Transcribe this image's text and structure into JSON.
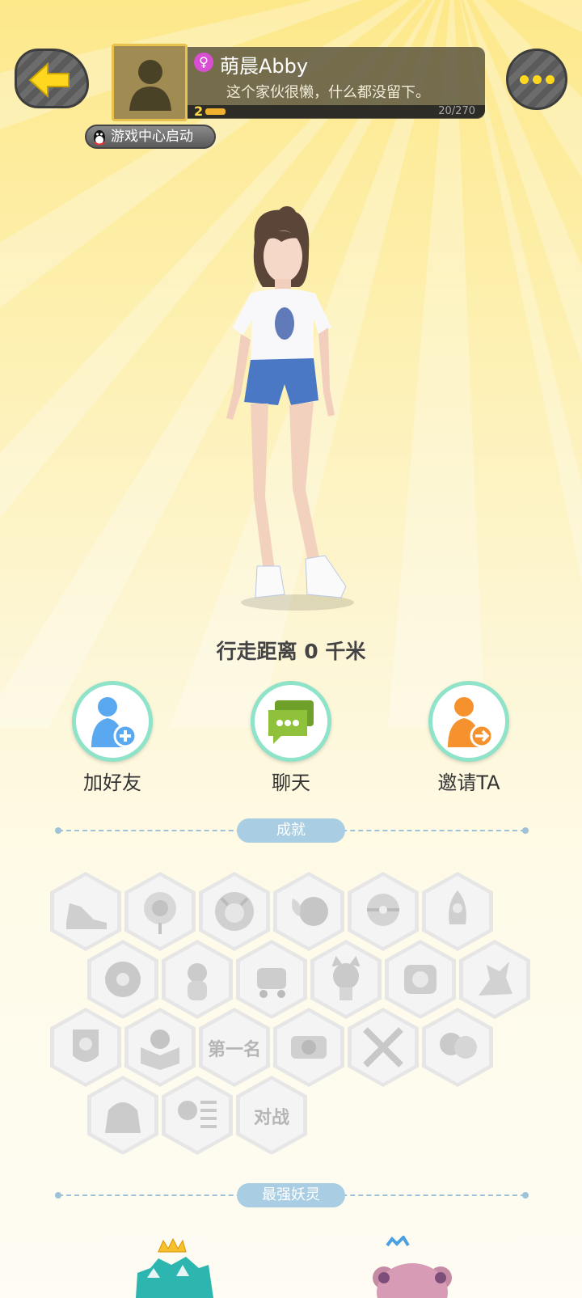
{
  "header": {
    "username": "萌晨Abby",
    "signature": "这个家伙很懒，什么都没留下。",
    "level": "2",
    "exp": "20/270",
    "exp_progress": 0.074,
    "game_center_label": "游戏中心启动",
    "gender_symbol": "♀"
  },
  "icons": {
    "back": "back-arrow-icon",
    "more": "more-dots-icon",
    "avatar": "default-avatar-icon",
    "qq": "qq-penguin-icon"
  },
  "main": {
    "distance": "行走距离 0 千米"
  },
  "actions": [
    {
      "label": "加好友",
      "icon": "add-friend-icon",
      "color": "#5aa8f0"
    },
    {
      "label": "聊天",
      "icon": "chat-icon",
      "color": "#8fc23a"
    },
    {
      "label": "邀请TA",
      "icon": "invite-icon",
      "color": "#f5922e"
    }
  ],
  "sections": {
    "achievements": "成就",
    "strongest_spirit": "最强妖灵"
  },
  "achievement_badges": [
    {
      "icon": "shoe-badge-icon"
    },
    {
      "icon": "target-badge-icon"
    },
    {
      "icon": "monster-badge-icon"
    },
    {
      "icon": "moon-badge-icon"
    },
    {
      "icon": "ball-badge-icon"
    },
    {
      "icon": "rocket-badge-icon"
    },
    {
      "icon": "vinyl-badge-icon"
    },
    {
      "icon": "pet-badge-icon"
    },
    {
      "icon": "cart-badge-icon"
    },
    {
      "icon": "cat-badge-icon"
    },
    {
      "icon": "camera-badge-icon"
    },
    {
      "icon": "dragon-badge-icon"
    },
    {
      "icon": "shield-badge-icon"
    },
    {
      "icon": "book-badge-icon"
    },
    {
      "icon": "first-place-badge-icon",
      "text": "第一名"
    },
    {
      "icon": "emblem-badge-icon"
    },
    {
      "icon": "swords-badge-icon"
    },
    {
      "icon": "friends-badge-icon"
    },
    {
      "icon": "bag-badge-icon"
    },
    {
      "icon": "list-badge-icon"
    },
    {
      "icon": "battle-badge-icon",
      "text": "对战"
    }
  ],
  "colors": {
    "accent": "#ffd71e",
    "pill": "#a9cde2",
    "ring": "#8fe3c9"
  }
}
